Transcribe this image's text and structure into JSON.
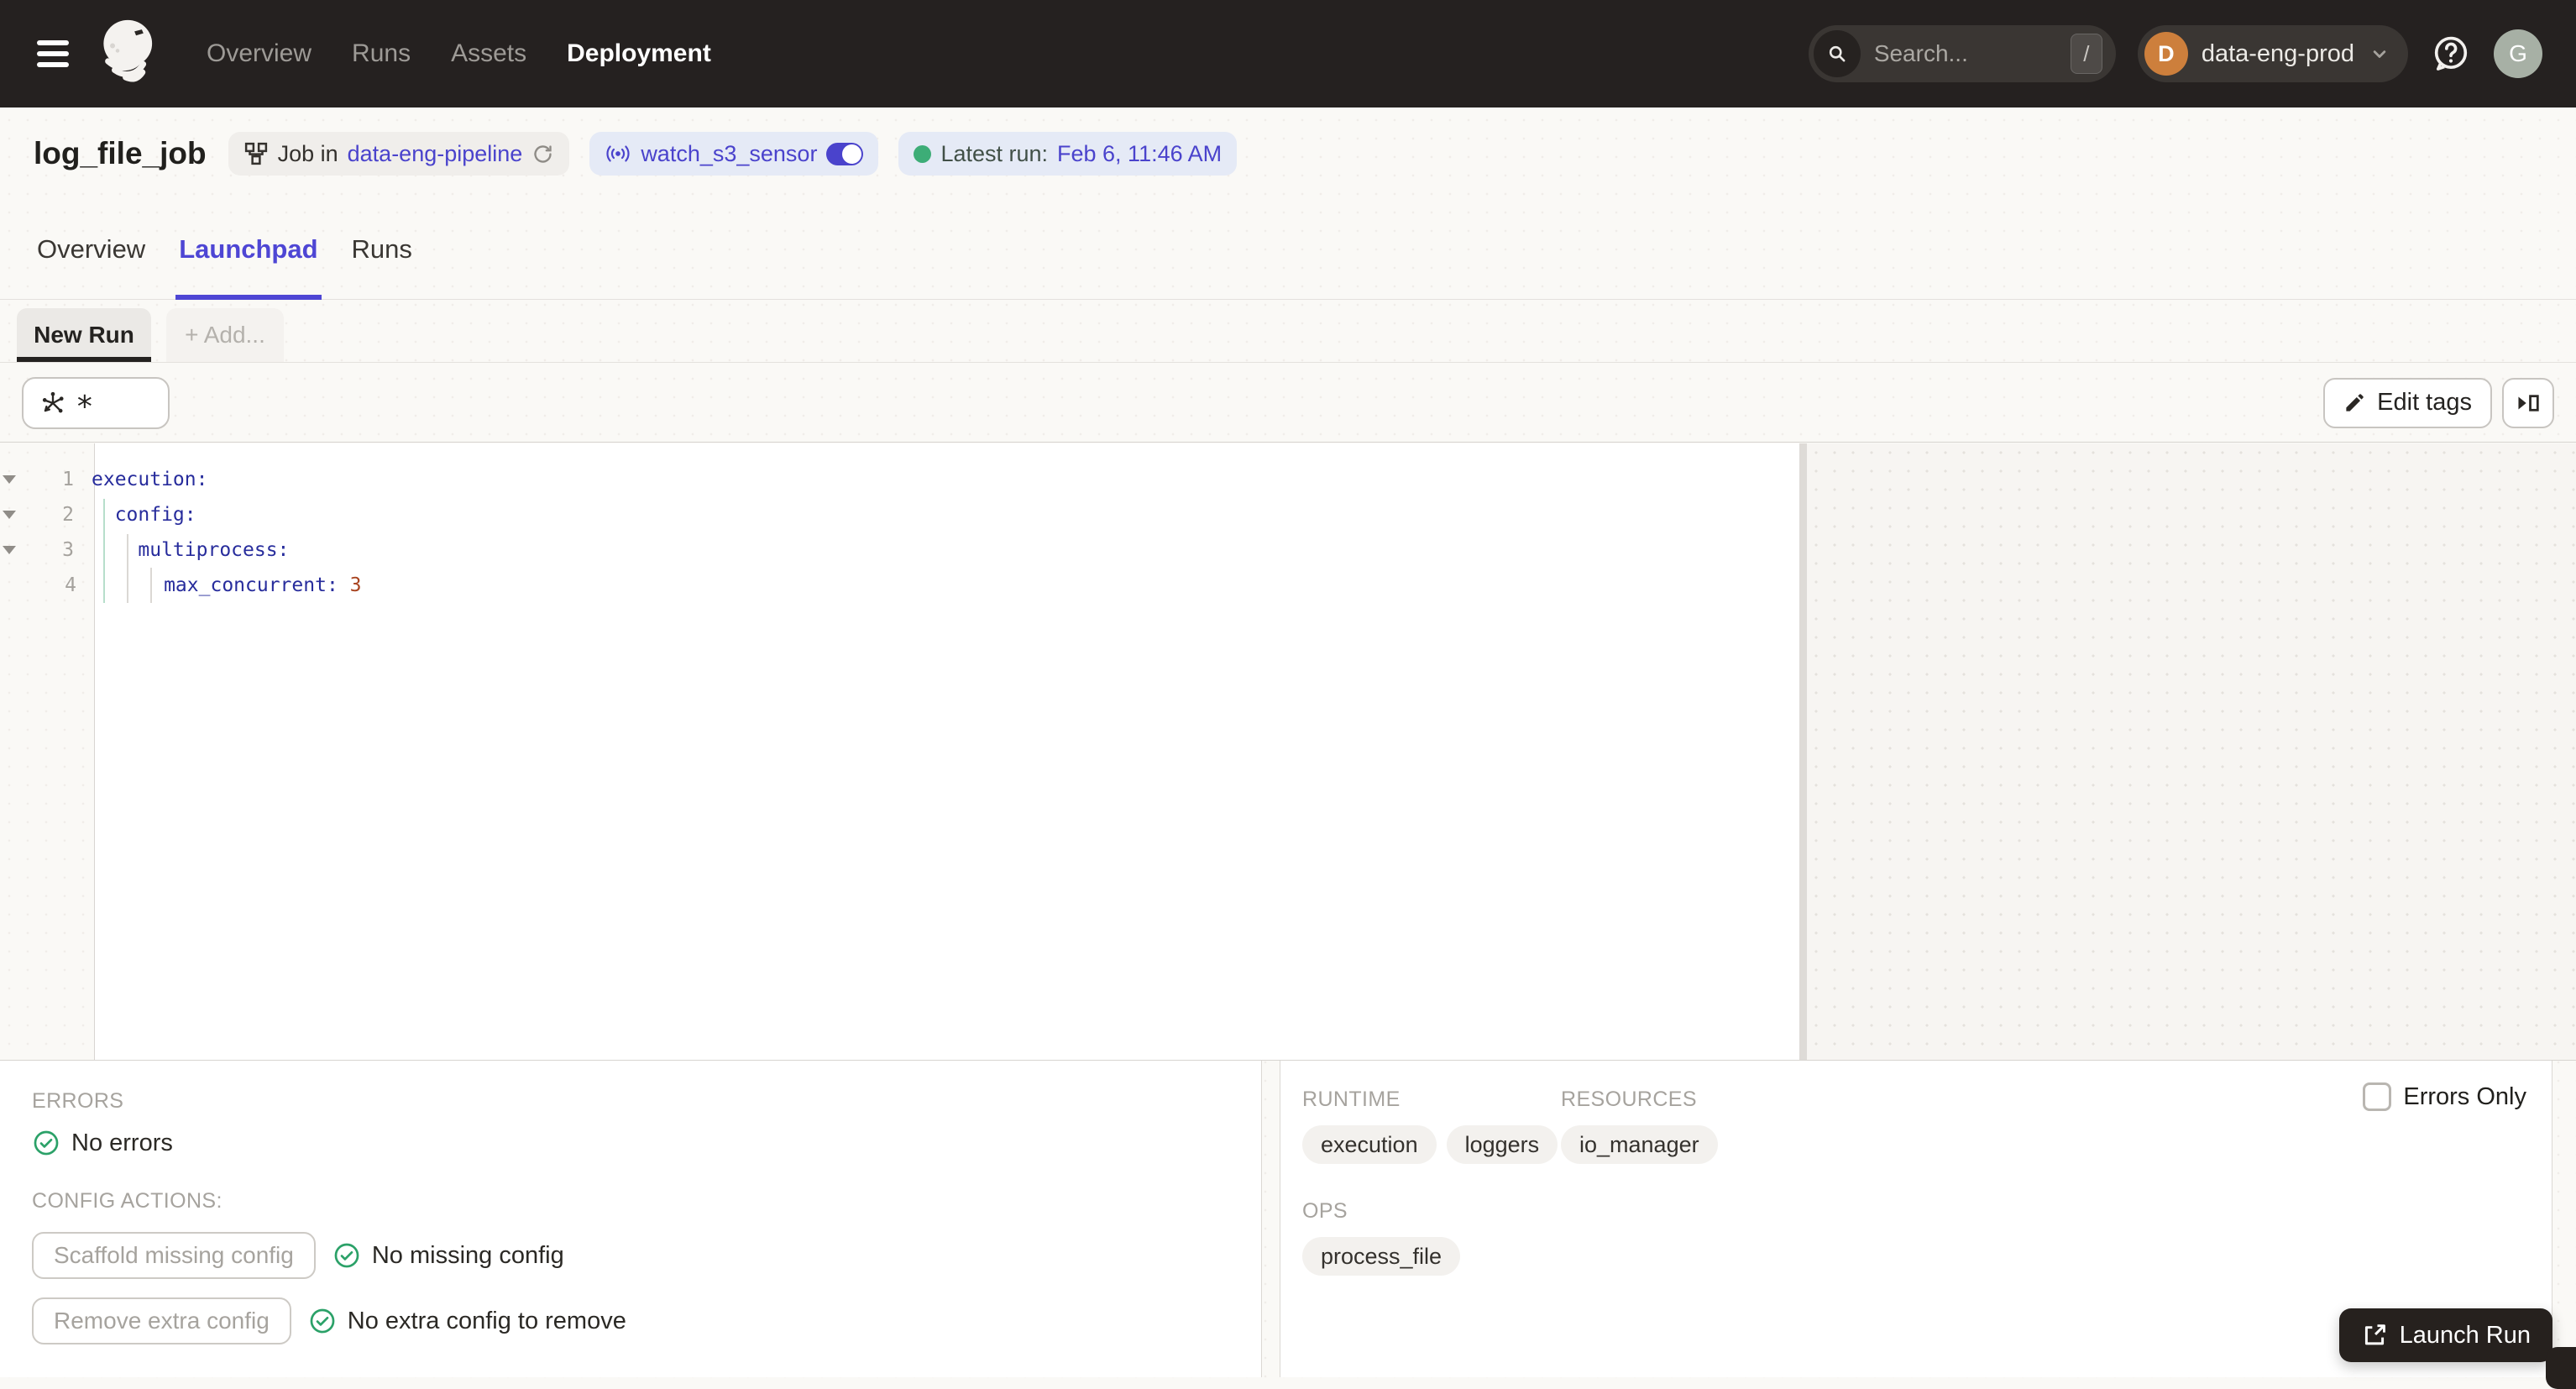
{
  "topnav": {
    "menu": [
      {
        "label": "Overview"
      },
      {
        "label": "Runs"
      },
      {
        "label": "Assets"
      },
      {
        "label": "Deployment",
        "active": true
      }
    ],
    "search": {
      "placeholder": "Search...",
      "shortcut": "/"
    },
    "workspace": {
      "initial": "D",
      "name": "data-eng-prod"
    },
    "user": {
      "initial": "G"
    }
  },
  "header": {
    "title": "log_file_job",
    "job_badge": {
      "prefix": "Job in",
      "link": "data-eng-pipeline"
    },
    "sensor_badge": {
      "label": "watch_s3_sensor",
      "state": "on"
    },
    "latest_run": {
      "prefix": "Latest run:",
      "timestamp": "Feb 6, 11:46 AM"
    }
  },
  "tabs": [
    {
      "label": "Overview"
    },
    {
      "label": "Launchpad",
      "active": true
    },
    {
      "label": "Runs"
    }
  ],
  "session": {
    "active_tab": "New Run",
    "add_tab": "+ Add..."
  },
  "toolbar": {
    "op_selector": "*",
    "edit_tags": "Edit tags"
  },
  "editor": {
    "language": "yaml",
    "lines": [
      {
        "num": "1",
        "code": "execution:",
        "value": "",
        "foldable": true
      },
      {
        "num": "2",
        "code": "  config:",
        "value": "",
        "foldable": true
      },
      {
        "num": "3",
        "code": "    multiprocess:",
        "value": "",
        "foldable": true
      },
      {
        "num": "4",
        "code": "      max_concurrent: ",
        "value": "3",
        "foldable": false
      }
    ]
  },
  "bottom": {
    "errors": {
      "heading": "ERRORS",
      "status": "No errors"
    },
    "config_actions": {
      "heading": "CONFIG ACTIONS:",
      "scaffold": {
        "button": "Scaffold missing config",
        "status": "No missing config"
      },
      "remove": {
        "button": "Remove extra config",
        "status": "No extra config to remove"
      }
    },
    "schema": {
      "runtime": {
        "heading": "RUNTIME",
        "chips": [
          "execution",
          "loggers"
        ]
      },
      "resources": {
        "heading": "RESOURCES",
        "chips": [
          "io_manager"
        ]
      },
      "ops": {
        "heading": "OPS",
        "chips": [
          "process_file"
        ]
      },
      "errors_only_label": "Errors Only"
    },
    "launch_button": "Launch Run"
  },
  "colors": {
    "accent_link": "#4A43CC",
    "tab_active": "#4E46D4",
    "success_green": "#2BA168",
    "status_dot_green": "#3DAD77",
    "code_key": "#272C9C",
    "code_value": "#A8431F",
    "navbar_bg": "#252120",
    "workspace_avatar": "#CD7F3C",
    "user_avatar": "#A7B0A5",
    "launch_button_bg": "#26211E"
  }
}
